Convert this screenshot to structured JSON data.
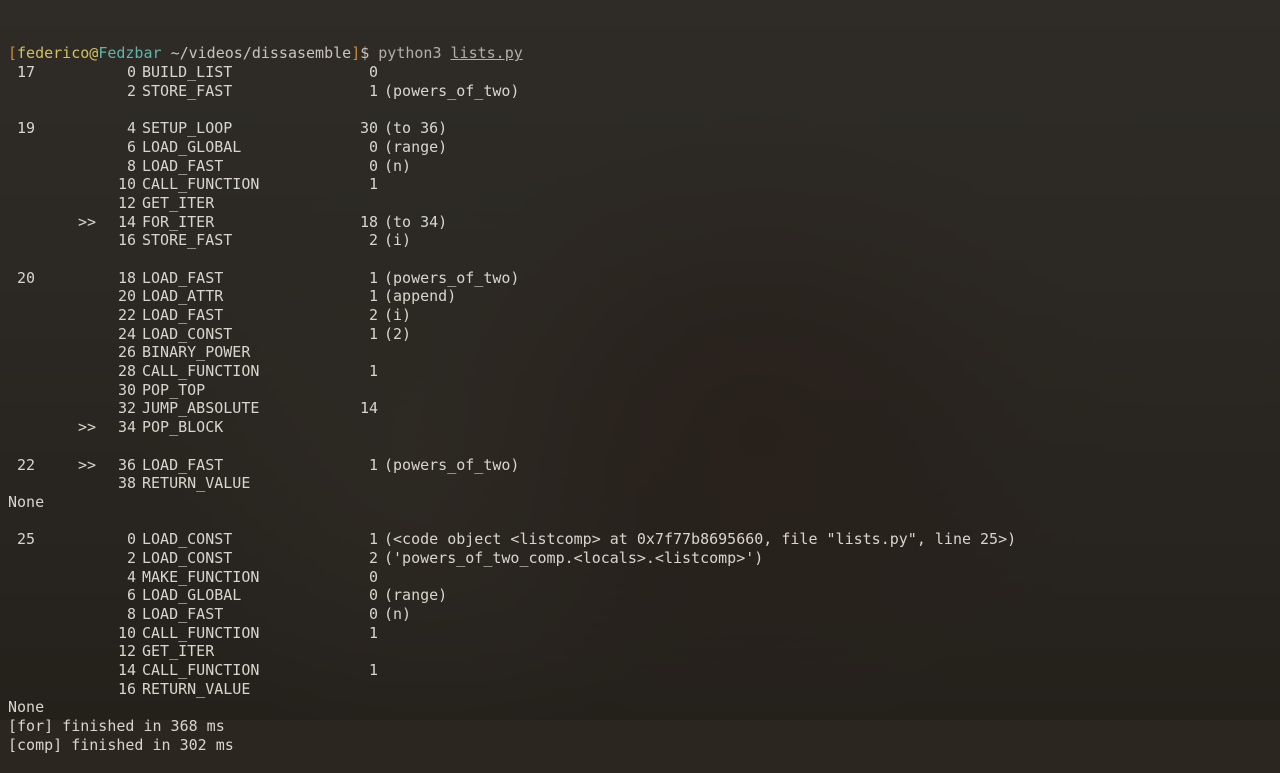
{
  "prompt": {
    "open": "[",
    "user": "federico",
    "at": "@",
    "host": "Fedzbar",
    "sep": " ",
    "path": "~/videos/dissasemble",
    "close": "]",
    "sigil": "$ ",
    "cmd": "python3",
    "arg": "lists.py"
  },
  "blocks": [
    {
      "rows": [
        {
          "lineno": "17",
          "mark": "",
          "off": "0",
          "op": "BUILD_LIST",
          "arg": "0",
          "note": ""
        },
        {
          "lineno": "",
          "mark": "",
          "off": "2",
          "op": "STORE_FAST",
          "arg": "1",
          "note": "(powers_of_two)"
        }
      ]
    },
    {
      "rows": [
        {
          "lineno": "19",
          "mark": "",
          "off": "4",
          "op": "SETUP_LOOP",
          "arg": "30",
          "note": "(to 36)"
        },
        {
          "lineno": "",
          "mark": "",
          "off": "6",
          "op": "LOAD_GLOBAL",
          "arg": "0",
          "note": "(range)"
        },
        {
          "lineno": "",
          "mark": "",
          "off": "8",
          "op": "LOAD_FAST",
          "arg": "0",
          "note": "(n)"
        },
        {
          "lineno": "",
          "mark": "",
          "off": "10",
          "op": "CALL_FUNCTION",
          "arg": "1",
          "note": ""
        },
        {
          "lineno": "",
          "mark": "",
          "off": "12",
          "op": "GET_ITER",
          "arg": "",
          "note": ""
        },
        {
          "lineno": "",
          "mark": ">>",
          "off": "14",
          "op": "FOR_ITER",
          "arg": "18",
          "note": "(to 34)"
        },
        {
          "lineno": "",
          "mark": "",
          "off": "16",
          "op": "STORE_FAST",
          "arg": "2",
          "note": "(i)"
        }
      ]
    },
    {
      "rows": [
        {
          "lineno": "20",
          "mark": "",
          "off": "18",
          "op": "LOAD_FAST",
          "arg": "1",
          "note": "(powers_of_two)"
        },
        {
          "lineno": "",
          "mark": "",
          "off": "20",
          "op": "LOAD_ATTR",
          "arg": "1",
          "note": "(append)"
        },
        {
          "lineno": "",
          "mark": "",
          "off": "22",
          "op": "LOAD_FAST",
          "arg": "2",
          "note": "(i)"
        },
        {
          "lineno": "",
          "mark": "",
          "off": "24",
          "op": "LOAD_CONST",
          "arg": "1",
          "note": "(2)"
        },
        {
          "lineno": "",
          "mark": "",
          "off": "26",
          "op": "BINARY_POWER",
          "arg": "",
          "note": ""
        },
        {
          "lineno": "",
          "mark": "",
          "off": "28",
          "op": "CALL_FUNCTION",
          "arg": "1",
          "note": ""
        },
        {
          "lineno": "",
          "mark": "",
          "off": "30",
          "op": "POP_TOP",
          "arg": "",
          "note": ""
        },
        {
          "lineno": "",
          "mark": "",
          "off": "32",
          "op": "JUMP_ABSOLUTE",
          "arg": "14",
          "note": ""
        },
        {
          "lineno": "",
          "mark": ">>",
          "off": "34",
          "op": "POP_BLOCK",
          "arg": "",
          "note": ""
        }
      ]
    },
    {
      "rows": [
        {
          "lineno": "22",
          "mark": ">>",
          "off": "36",
          "op": "LOAD_FAST",
          "arg": "1",
          "note": "(powers_of_two)"
        },
        {
          "lineno": "",
          "mark": "",
          "off": "38",
          "op": "RETURN_VALUE",
          "arg": "",
          "note": ""
        }
      ]
    }
  ],
  "none1": "None",
  "blocks2": [
    {
      "rows": [
        {
          "lineno": "25",
          "mark": "",
          "off": "0",
          "op": "LOAD_CONST",
          "arg": "1",
          "note": "(<code object <listcomp> at 0x7f77b8695660, file \"lists.py\", line 25>)"
        },
        {
          "lineno": "",
          "mark": "",
          "off": "2",
          "op": "LOAD_CONST",
          "arg": "2",
          "note": "('powers_of_two_comp.<locals>.<listcomp>')"
        },
        {
          "lineno": "",
          "mark": "",
          "off": "4",
          "op": "MAKE_FUNCTION",
          "arg": "0",
          "note": ""
        },
        {
          "lineno": "",
          "mark": "",
          "off": "6",
          "op": "LOAD_GLOBAL",
          "arg": "0",
          "note": "(range)"
        },
        {
          "lineno": "",
          "mark": "",
          "off": "8",
          "op": "LOAD_FAST",
          "arg": "0",
          "note": "(n)"
        },
        {
          "lineno": "",
          "mark": "",
          "off": "10",
          "op": "CALL_FUNCTION",
          "arg": "1",
          "note": ""
        },
        {
          "lineno": "",
          "mark": "",
          "off": "12",
          "op": "GET_ITER",
          "arg": "",
          "note": ""
        },
        {
          "lineno": "",
          "mark": "",
          "off": "14",
          "op": "CALL_FUNCTION",
          "arg": "1",
          "note": ""
        },
        {
          "lineno": "",
          "mark": "",
          "off": "16",
          "op": "RETURN_VALUE",
          "arg": "",
          "note": ""
        }
      ]
    }
  ],
  "none2": "None",
  "timing": [
    "[for] finished in 368 ms",
    "[comp] finished in 302 ms"
  ]
}
